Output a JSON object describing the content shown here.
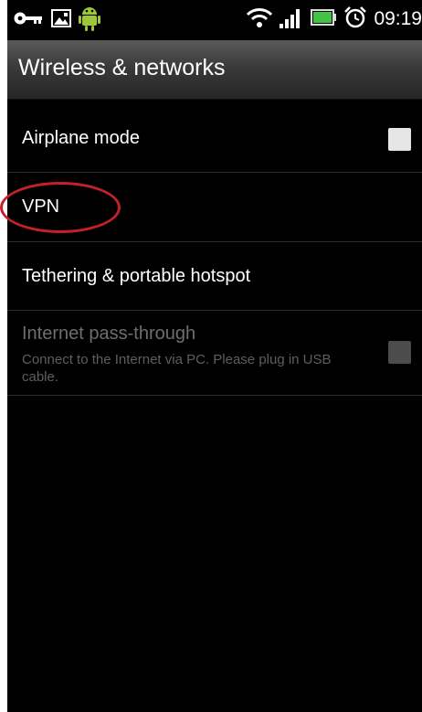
{
  "status_bar": {
    "time": "09:19",
    "left_icons": [
      "vpn-key-icon",
      "image-icon",
      "android-icon"
    ],
    "right_icons": [
      "wifi-icon",
      "signal-icon",
      "battery-icon",
      "alarm-clock-icon"
    ]
  },
  "header": {
    "title": "Wireless & networks"
  },
  "settings": {
    "items": [
      {
        "label": "Airplane mode",
        "checked": false
      },
      {
        "label": "VPN",
        "highlighted": true
      },
      {
        "label": "Tethering & portable hotspot"
      },
      {
        "label": "Internet pass-through",
        "summary": "Connect to the Internet via PC. Please plug in USB cable.",
        "enabled": false,
        "checked": false
      }
    ]
  },
  "colors": {
    "annotation_circle": "#c5202a",
    "background": "#000000"
  }
}
